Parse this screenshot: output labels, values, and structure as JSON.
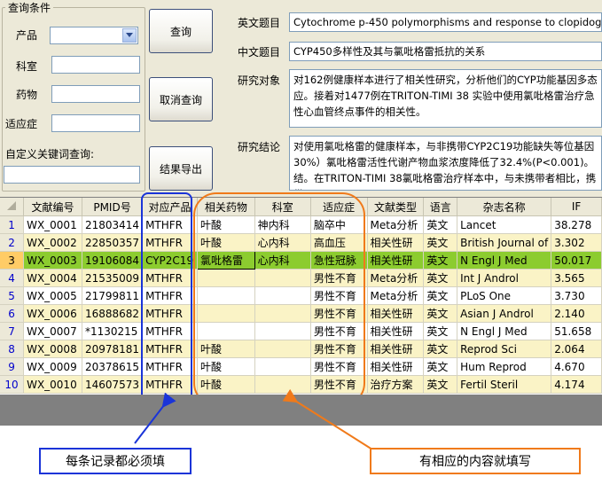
{
  "query_panel": {
    "group_title": "查询条件",
    "product_label": "产品",
    "product_value": "",
    "dept_label": "科室",
    "dept_value": "",
    "drug_label": "药物",
    "drug_value": "",
    "indication_label": "适应症",
    "indication_value": "",
    "custom_keyword_label": "自定义关键词查询:",
    "custom_keyword_value": ""
  },
  "buttons": {
    "query": "查询",
    "cancel_query": "取消查询",
    "export": "结果导出"
  },
  "detail": {
    "en_title_label": "英文题目",
    "en_title": "Cytochrome p-450 polymorphisms and response to clopidogrel",
    "cn_title_label": "中文题目",
    "cn_title": "CYP450多样性及其与氯吡格雷抵抗的关系",
    "subject_label": "研究对象",
    "subject_text": "对162例健康样本进行了相关性研究，分析他们的CYP功能基因多态应。接着对1477例在TRITON-TIMI 38 实验中使用氯吡格雷治疗急性心血管终点事件的相关性。",
    "conclusion_label": "研究结论",
    "conclusion_text": "对使用氯吡格雷的健康样本，与非携带CYP2C19功能缺失等位基因30%）氯吡格雷活性代谢产物血浆浓度降低了32.4%(P<0.001)。结。在TRITON-TIMI 38氯吡格雷治疗样本中，与未携带者相比，携带"
  },
  "grid": {
    "columns": [
      "文献编号",
      "PMID号",
      "对应产品",
      "相关药物",
      "科室",
      "适应症",
      "文献类型",
      "语言",
      "杂志名称",
      "IF"
    ],
    "rows": [
      {
        "n": "1",
        "cells": [
          "WX_0001",
          "21803414",
          "MTHFR",
          "叶酸",
          "神内科",
          "脑卒中",
          "Meta分析",
          "英文",
          "Lancet",
          "38.278"
        ]
      },
      {
        "n": "2",
        "cells": [
          "WX_0002",
          "22850357",
          "MTHFR",
          "叶酸",
          "心内科",
          "高血压",
          "相关性研",
          "英文",
          "British Journal of",
          "3.302"
        ]
      },
      {
        "n": "3",
        "cells": [
          "WX_0003",
          "19106084",
          "CYP2C19",
          "氯吡格雷",
          "心内科",
          "急性冠脉",
          "相关性研",
          "英文",
          "N Engl J Med",
          "50.017"
        ]
      },
      {
        "n": "4",
        "cells": [
          "WX_0004",
          "21535009",
          "MTHFR",
          "",
          "",
          "男性不育",
          "Meta分析",
          "英文",
          "Int J Androl",
          "3.565"
        ]
      },
      {
        "n": "5",
        "cells": [
          "WX_0005",
          "21799811",
          "MTHFR",
          "",
          "",
          "男性不育",
          "Meta分析",
          "英文",
          "PLoS One",
          "3.730"
        ]
      },
      {
        "n": "6",
        "cells": [
          "WX_0006",
          "16888682",
          "MTHFR",
          "",
          "",
          "男性不育",
          "相关性研",
          "英文",
          "Asian J Androl",
          "2.140"
        ]
      },
      {
        "n": "7",
        "cells": [
          "WX_0007",
          "*1130215",
          "MTHFR",
          "",
          "",
          "男性不育",
          "相关性研",
          "英文",
          "N Engl J Med",
          "51.658"
        ]
      },
      {
        "n": "8",
        "cells": [
          "WX_0008",
          "20978181",
          "MTHFR",
          "叶酸",
          "",
          "男性不育",
          "相关性研",
          "英文",
          "Reprod Sci",
          "2.064"
        ]
      },
      {
        "n": "9",
        "cells": [
          "WX_0009",
          "20378615",
          "MTHFR",
          "叶酸",
          "",
          "男性不育",
          "相关性研",
          "英文",
          "Hum Reprod",
          "4.670"
        ]
      },
      {
        "n": "10",
        "cells": [
          "WX_0010",
          "14607573",
          "MTHFR",
          "叶酸",
          "",
          "男性不育",
          "治疗方案",
          "英文",
          "Fertil Steril",
          "4.174"
        ]
      }
    ]
  },
  "callouts": {
    "required": "每条记录都必须填",
    "optional": "有相应的内容就填写"
  },
  "colors": {
    "callout_blue": "#1a34d8",
    "callout_orange": "#f07a1a",
    "selected_row": "#8ccc2f",
    "alt_row": "#faf3c6"
  },
  "icons": {
    "combo_arrow": "chevron-down-icon"
  }
}
